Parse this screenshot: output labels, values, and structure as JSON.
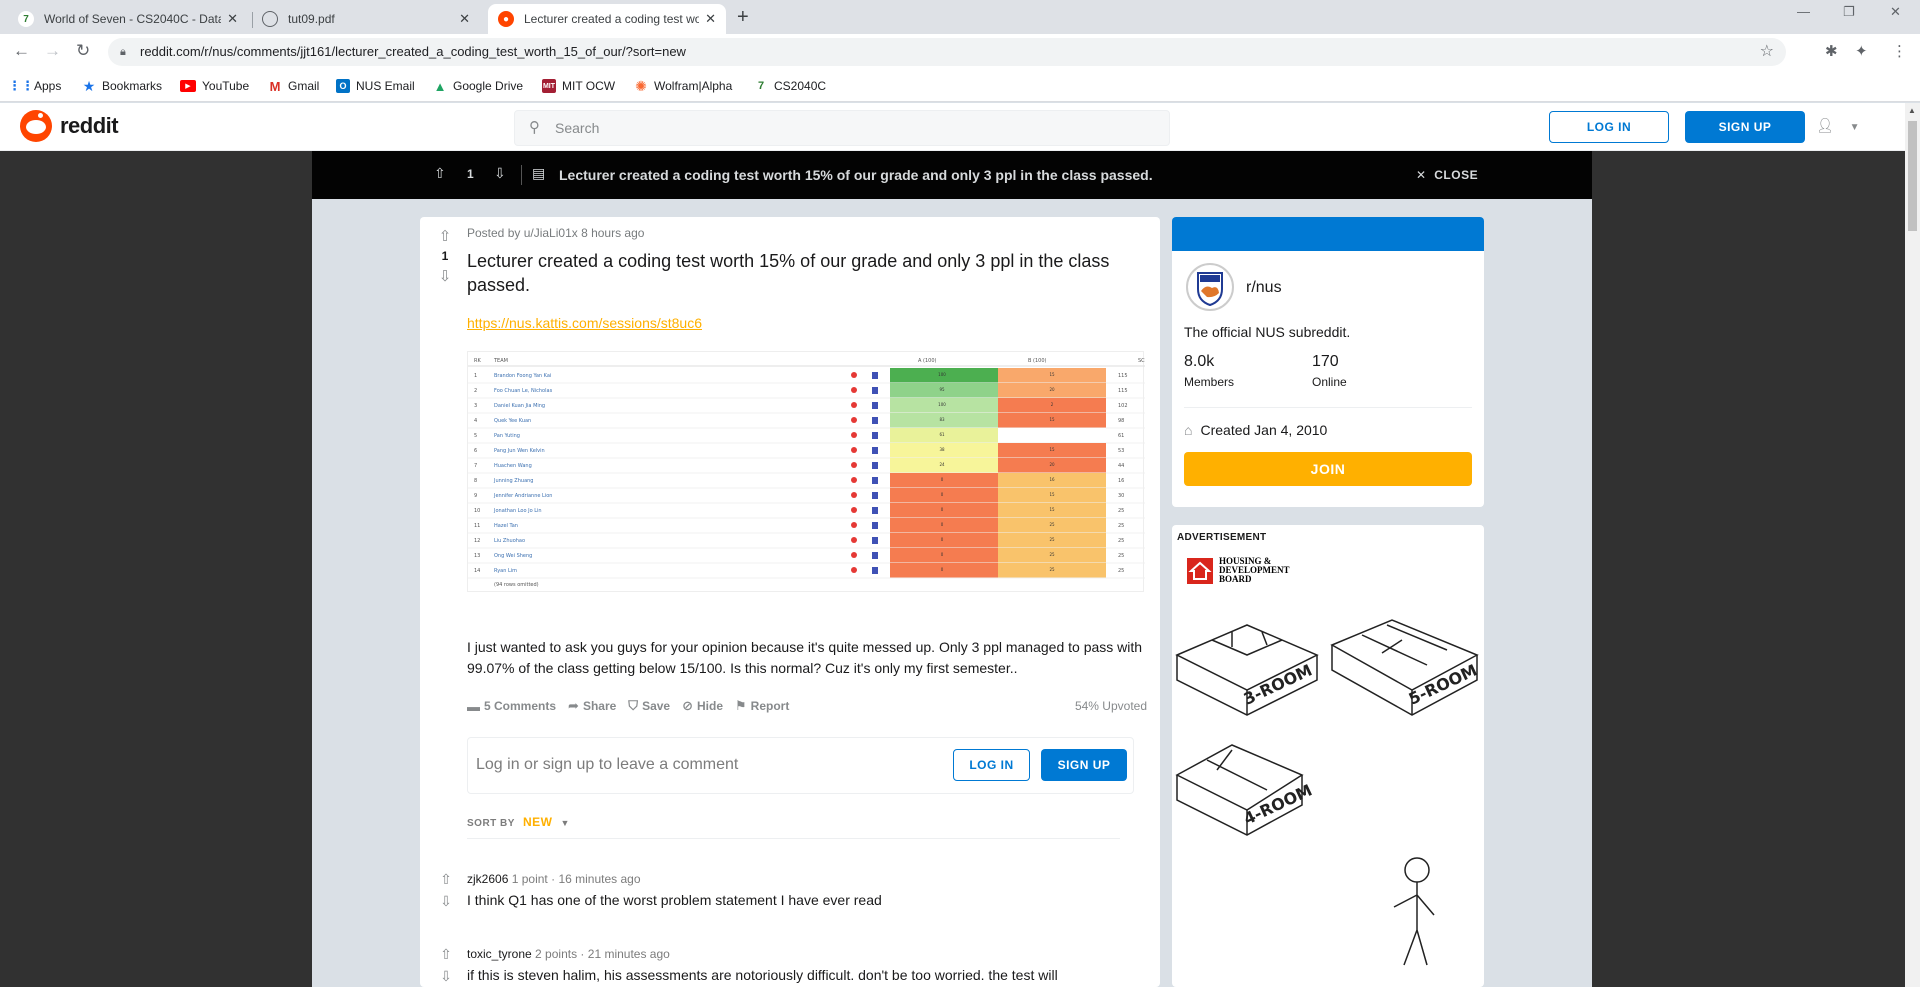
{
  "browser": {
    "tabs": [
      {
        "title": "World of Seven - CS2040C - Data",
        "favicon": "7",
        "active": false
      },
      {
        "title": "tut09.pdf",
        "favicon": "globe",
        "active": false
      },
      {
        "title": "Lecturer created a coding test wo",
        "favicon": "reddit",
        "active": true
      }
    ],
    "new_tab": "+",
    "url": "reddit.com/r/nus/comments/jjt161/lecturer_created_a_coding_test_worth_15_of_our/?sort=new",
    "bookmarks": [
      {
        "label": "Apps",
        "icon": "apps-icon",
        "color": "#1a73e8"
      },
      {
        "label": "Bookmarks",
        "icon": "star-icon",
        "color": "#1a73e8"
      },
      {
        "label": "YouTube",
        "icon": "youtube-icon",
        "color": "#ff0000"
      },
      {
        "label": "Gmail",
        "icon": "gmail-icon",
        "color": "#d93025"
      },
      {
        "label": "NUS Email",
        "icon": "outlook-icon",
        "color": "#0072c6"
      },
      {
        "label": "Google Drive",
        "icon": "drive-icon",
        "color": "#1fa463"
      },
      {
        "label": "MIT OCW",
        "icon": "mit-icon",
        "color": "#a31f34"
      },
      {
        "label": "Wolfram|Alpha",
        "icon": "wolfram-icon",
        "color": "#f96932"
      },
      {
        "label": "CS2040C",
        "icon": "seven-icon",
        "color": "#2e7d32"
      }
    ]
  },
  "reddit": {
    "logo_text": "reddit",
    "search_placeholder": "Search",
    "login": "LOG IN",
    "signup": "SIGN UP",
    "brand_color": "#ff4500",
    "accent": "#0079d3"
  },
  "postbar": {
    "score": "1",
    "title": "Lecturer created a coding test worth 15% of our grade and only 3 ppl in the class passed.",
    "close": "CLOSE"
  },
  "post": {
    "score": "1",
    "meta": "Posted by u/JiaLi01x 8 hours ago",
    "title": "Lecturer created a coding test worth 15% of our grade and only 3 ppl in the class passed.",
    "link": "https://nus.kattis.com/sessions/st8uc6",
    "body": "I just wanted to ask you guys for your opinion because it's quite messed up. Only 3 ppl managed to pass with 99.07% of the class getting below 15/100. Is this normal? Cuz it's only my first semester..",
    "actions": {
      "comments": "5 Comments",
      "share": "Share",
      "save": "Save",
      "hide": "Hide",
      "report": "Report"
    },
    "upvoted": "54% Upvoted",
    "comment_placeholder": "Log in or sign up to leave a comment",
    "comment_login": "LOG IN",
    "comment_signup": "SIGN UP",
    "sort_label": "SORT BY",
    "sort_value": "NEW"
  },
  "comments": [
    {
      "author": "zjk2606",
      "points": "1 point",
      "age": "16 minutes ago",
      "text": "I think Q1 has one of the worst problem statement I have ever read"
    },
    {
      "author": "toxic_tyrone",
      "points": "2 points",
      "age": "21 minutes ago",
      "text": "if this is steven halim, his assessments are notoriously difficult. don't be too worried. the test will"
    }
  ],
  "sidebar": {
    "subreddit": "r/nus",
    "description": "The official NUS subreddit.",
    "members_value": "8.0k",
    "members_label": "Members",
    "online_value": "170",
    "online_label": "Online",
    "created": "Created Jan 4, 2010",
    "join": "JOIN"
  },
  "ad": {
    "label": "ADVERTISEMENT",
    "brand_line1": "HOUSING &",
    "brand_line2": "DEVELOPMENT",
    "brand_line3": "BOARD",
    "room_labels": [
      "3-ROOM",
      "5-ROOM",
      "4-ROOM"
    ]
  },
  "scoreboard": {
    "headers": [
      "RK",
      "TEAM",
      "A (100)",
      "B (100)",
      "SCORE"
    ],
    "rows": [
      {
        "rank": "1",
        "name": "Brandon Foong Yan Kai",
        "a": "100",
        "b": "15",
        "score": "115",
        "ac": "#4caf50",
        "bc": "#f9a86b"
      },
      {
        "rank": "2",
        "name": "Foo Chuan Le, Nicholas",
        "a": "95",
        "b": "20",
        "score": "115",
        "ac": "#8fd28a",
        "bc": "#f9a86b"
      },
      {
        "rank": "3",
        "name": "Daniel Kuan Jia Ming",
        "a": "100",
        "b": "2",
        "score": "102",
        "ac": "#b7e3a2",
        "bc": "#f57c50"
      },
      {
        "rank": "4",
        "name": "Quek Yee Kuan",
        "a": "83",
        "b": "15",
        "score": "98",
        "ac": "#b7e3a2",
        "bc": "#f57c50"
      },
      {
        "rank": "5",
        "name": "Pan Yuting",
        "a": "61",
        "b": "",
        "score": "61",
        "ac": "#e9f29a",
        "bc": "#fff"
      },
      {
        "rank": "6",
        "name": "Pang Jun Wen Kelvin",
        "a": "38",
        "b": "15",
        "score": "53",
        "ac": "#f7f59a",
        "bc": "#f57c50"
      },
      {
        "rank": "7",
        "name": "Huachen Wang",
        "a": "24",
        "b": "20",
        "score": "44",
        "ac": "#f7f59a",
        "bc": "#f57c50"
      },
      {
        "rank": "8",
        "name": "Junning Zhuang",
        "a": "0",
        "b": "16",
        "score": "16",
        "ac": "#f57c50",
        "bc": "#f9c36b"
      },
      {
        "rank": "9",
        "name": "Jennifer Andrianne Lion",
        "a": "0",
        "b": "15",
        "score": "30",
        "ac": "#f57c50",
        "bc": "#f9c36b"
      },
      {
        "rank": "10",
        "name": "Jonathan Loo Jo Lin",
        "a": "0",
        "b": "15",
        "score": "25",
        "ac": "#f57c50",
        "bc": "#f9c36b"
      },
      {
        "rank": "11",
        "name": "Hazel Tan",
        "a": "0",
        "b": "25",
        "score": "25",
        "ac": "#f57c50",
        "bc": "#f9c36b"
      },
      {
        "rank": "12",
        "name": "Liu Zhuohao",
        "a": "0",
        "b": "25",
        "score": "25",
        "ac": "#f57c50",
        "bc": "#f9c36b"
      },
      {
        "rank": "13",
        "name": "Ong Wei Sheng",
        "a": "0",
        "b": "25",
        "score": "25",
        "ac": "#f57c50",
        "bc": "#f9c36b"
      },
      {
        "rank": "14",
        "name": "Ryan Lim",
        "a": "0",
        "b": "25",
        "score": "25",
        "ac": "#f57c50",
        "bc": "#f9c36b"
      }
    ],
    "footer": "(94 rows omitted)"
  }
}
